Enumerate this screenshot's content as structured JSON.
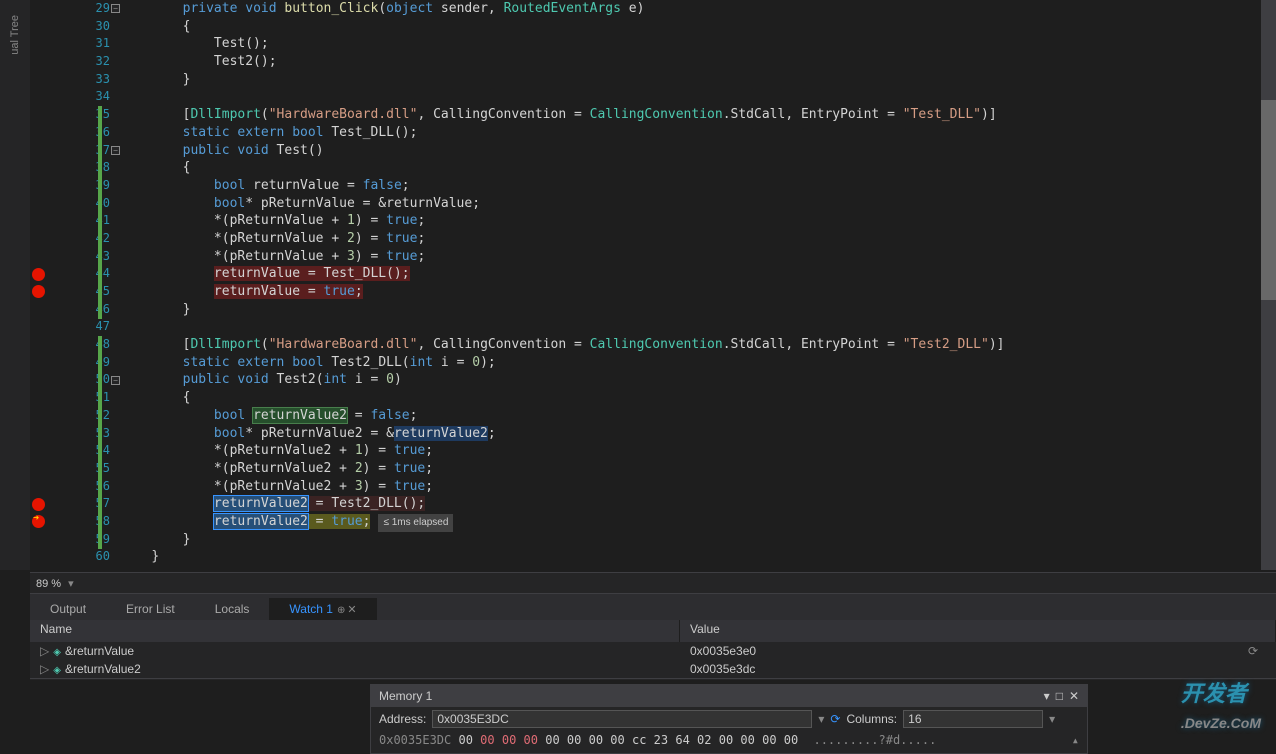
{
  "side_panel": {
    "label": "ual Tree"
  },
  "line_numbers": [
    29,
    30,
    31,
    32,
    33,
    34,
    35,
    36,
    37,
    38,
    39,
    40,
    41,
    42,
    43,
    44,
    45,
    46,
    47,
    48,
    49,
    50,
    51,
    52,
    53,
    54,
    55,
    56,
    57,
    58,
    59,
    60
  ],
  "breakpoints": [
    {
      "line": 44,
      "type": "normal"
    },
    {
      "line": 45,
      "type": "normal"
    },
    {
      "line": 57,
      "type": "normal"
    },
    {
      "line": 58,
      "type": "arrow"
    }
  ],
  "modified_ranges": [
    [
      35,
      46
    ],
    [
      48,
      59
    ]
  ],
  "fold_markers": [
    29,
    37,
    50
  ],
  "code_lines": [
    {
      "n": 29,
      "indent": 2,
      "tokens": [
        {
          "t": "private",
          "c": "k"
        },
        {
          "t": " "
        },
        {
          "t": "void",
          "c": "k"
        },
        {
          "t": " "
        },
        {
          "t": "button_Click",
          "c": "m"
        },
        {
          "t": "("
        },
        {
          "t": "object",
          "c": "k"
        },
        {
          "t": " sender, "
        },
        {
          "t": "RoutedEventArgs",
          "c": "t"
        },
        {
          "t": " e)"
        }
      ]
    },
    {
      "n": 30,
      "indent": 2,
      "tokens": [
        {
          "t": "{"
        }
      ]
    },
    {
      "n": 31,
      "indent": 3,
      "tokens": [
        {
          "t": "Test();"
        }
      ]
    },
    {
      "n": 32,
      "indent": 3,
      "tokens": [
        {
          "t": "Test2();"
        }
      ]
    },
    {
      "n": 33,
      "indent": 2,
      "tokens": [
        {
          "t": "}"
        }
      ]
    },
    {
      "n": 34,
      "indent": 0,
      "tokens": []
    },
    {
      "n": 35,
      "indent": 2,
      "tokens": [
        {
          "t": "["
        },
        {
          "t": "DllImport",
          "c": "attr"
        },
        {
          "t": "("
        },
        {
          "t": "\"HardwareBoard.dll\"",
          "c": "s"
        },
        {
          "t": ", CallingConvention = "
        },
        {
          "t": "CallingConvention",
          "c": "t"
        },
        {
          "t": ".StdCall, EntryPoint = "
        },
        {
          "t": "\"Test_DLL\"",
          "c": "s"
        },
        {
          "t": ")]"
        }
      ]
    },
    {
      "n": 36,
      "indent": 2,
      "tokens": [
        {
          "t": "static",
          "c": "k"
        },
        {
          "t": " "
        },
        {
          "t": "extern",
          "c": "k"
        },
        {
          "t": " "
        },
        {
          "t": "bool",
          "c": "k"
        },
        {
          "t": " Test_DLL();"
        }
      ]
    },
    {
      "n": 37,
      "indent": 2,
      "tokens": [
        {
          "t": "public",
          "c": "k"
        },
        {
          "t": " "
        },
        {
          "t": "void",
          "c": "k"
        },
        {
          "t": " Test()"
        }
      ]
    },
    {
      "n": 38,
      "indent": 2,
      "tokens": [
        {
          "t": "{"
        }
      ]
    },
    {
      "n": 39,
      "indent": 3,
      "tokens": [
        {
          "t": "bool",
          "c": "k"
        },
        {
          "t": " returnValue = "
        },
        {
          "t": "false",
          "c": "k"
        },
        {
          "t": ";"
        }
      ]
    },
    {
      "n": 40,
      "indent": 3,
      "tokens": [
        {
          "t": "bool",
          "c": "k"
        },
        {
          "t": "* pReturnValue = &returnValue;"
        }
      ]
    },
    {
      "n": 41,
      "indent": 3,
      "tokens": [
        {
          "t": "*(pReturnValue + "
        },
        {
          "t": "1",
          "c": "n"
        },
        {
          "t": ") = "
        },
        {
          "t": "true",
          "c": "k"
        },
        {
          "t": ";"
        }
      ]
    },
    {
      "n": 42,
      "indent": 3,
      "tokens": [
        {
          "t": "*(pReturnValue + "
        },
        {
          "t": "2",
          "c": "n"
        },
        {
          "t": ") = "
        },
        {
          "t": "true",
          "c": "k"
        },
        {
          "t": ";"
        }
      ]
    },
    {
      "n": 43,
      "indent": 3,
      "tokens": [
        {
          "t": "*(pReturnValue + "
        },
        {
          "t": "3",
          "c": "n"
        },
        {
          "t": ") = "
        },
        {
          "t": "true",
          "c": "k"
        },
        {
          "t": ";"
        }
      ]
    },
    {
      "n": 44,
      "indent": 3,
      "tokens": [
        {
          "t": "returnValue = Test_DLL();",
          "hl": "hl-red"
        }
      ]
    },
    {
      "n": 45,
      "indent": 3,
      "tokens": [
        {
          "t": "returnValue = ",
          "hl": "hl-red"
        },
        {
          "t": "true",
          "c": "k",
          "hl": "hl-red"
        },
        {
          "t": ";",
          "hl": "hl-red"
        }
      ]
    },
    {
      "n": 46,
      "indent": 2,
      "tokens": [
        {
          "t": "}"
        }
      ]
    },
    {
      "n": 47,
      "indent": 0,
      "tokens": []
    },
    {
      "n": 48,
      "indent": 2,
      "tokens": [
        {
          "t": "["
        },
        {
          "t": "DllImport",
          "c": "attr"
        },
        {
          "t": "("
        },
        {
          "t": "\"HardwareBoard.dll\"",
          "c": "s"
        },
        {
          "t": ", CallingConvention = "
        },
        {
          "t": "CallingConvention",
          "c": "t"
        },
        {
          "t": ".StdCall, EntryPoint = "
        },
        {
          "t": "\"Test2_DLL\"",
          "c": "s"
        },
        {
          "t": ")]"
        }
      ]
    },
    {
      "n": 49,
      "indent": 2,
      "tokens": [
        {
          "t": "static",
          "c": "k"
        },
        {
          "t": " "
        },
        {
          "t": "extern",
          "c": "k"
        },
        {
          "t": " "
        },
        {
          "t": "bool",
          "c": "k"
        },
        {
          "t": " Test2_DLL("
        },
        {
          "t": "int",
          "c": "k"
        },
        {
          "t": " i = "
        },
        {
          "t": "0",
          "c": "n"
        },
        {
          "t": ");"
        }
      ]
    },
    {
      "n": 50,
      "indent": 2,
      "tokens": [
        {
          "t": "public",
          "c": "k"
        },
        {
          "t": " "
        },
        {
          "t": "void",
          "c": "k"
        },
        {
          "t": " Test2("
        },
        {
          "t": "int",
          "c": "k"
        },
        {
          "t": " i = "
        },
        {
          "t": "0",
          "c": "n"
        },
        {
          "t": ")"
        }
      ]
    },
    {
      "n": 51,
      "indent": 2,
      "tokens": [
        {
          "t": "{"
        }
      ]
    },
    {
      "n": 52,
      "indent": 3,
      "tokens": [
        {
          "t": "bool",
          "c": "k"
        },
        {
          "t": " "
        },
        {
          "t": "returnValue2",
          "hl": "hl-green-box"
        },
        {
          "t": " = "
        },
        {
          "t": "false",
          "c": "k"
        },
        {
          "t": ";"
        }
      ]
    },
    {
      "n": 53,
      "indent": 3,
      "tokens": [
        {
          "t": "bool",
          "c": "k"
        },
        {
          "t": "* pReturnValue2 = &"
        },
        {
          "t": "returnValue2",
          "hl": "hl-blue-dark"
        },
        {
          "t": ";"
        }
      ]
    },
    {
      "n": 54,
      "indent": 3,
      "tokens": [
        {
          "t": "*(pReturnValue2 + "
        },
        {
          "t": "1",
          "c": "n"
        },
        {
          "t": ") = "
        },
        {
          "t": "true",
          "c": "k"
        },
        {
          "t": ";"
        }
      ]
    },
    {
      "n": 55,
      "indent": 3,
      "tokens": [
        {
          "t": "*(pReturnValue2 + "
        },
        {
          "t": "2",
          "c": "n"
        },
        {
          "t": ") = "
        },
        {
          "t": "true",
          "c": "k"
        },
        {
          "t": ";"
        }
      ]
    },
    {
      "n": 56,
      "indent": 3,
      "tokens": [
        {
          "t": "*(pReturnValue2 + "
        },
        {
          "t": "3",
          "c": "n"
        },
        {
          "t": ") = "
        },
        {
          "t": "true",
          "c": "k"
        },
        {
          "t": ";"
        }
      ]
    },
    {
      "n": 57,
      "indent": 3,
      "tokens": [
        {
          "t": "returnValue2",
          "hl": "hl-blue"
        },
        {
          "t": " = Test2_DLL();",
          "hl": "hl-dark"
        }
      ]
    },
    {
      "n": 58,
      "indent": 3,
      "current": true,
      "tokens": [
        {
          "t": "returnValue2",
          "hl": "hl-blue"
        },
        {
          "t": " = ",
          "hl": "hl-yellow"
        },
        {
          "t": "true",
          "c": "k",
          "hl": "hl-yellow"
        },
        {
          "t": ";",
          "hl": "hl-yellow"
        }
      ],
      "hint": "≤ 1ms elapsed"
    },
    {
      "n": 59,
      "indent": 2,
      "tokens": [
        {
          "t": "}"
        }
      ]
    },
    {
      "n": 60,
      "indent": 1,
      "tokens": [
        {
          "t": "}"
        }
      ]
    }
  ],
  "zoom": {
    "value": "89 %"
  },
  "tabs": [
    {
      "label": "Output",
      "active": false
    },
    {
      "label": "Error List",
      "active": false
    },
    {
      "label": "Locals",
      "active": false
    },
    {
      "label": "Watch 1",
      "active": true
    }
  ],
  "watch": {
    "columns": {
      "name": "Name",
      "value": "Value"
    },
    "rows": [
      {
        "name": "&returnValue",
        "value": "0x0035e3e0"
      },
      {
        "name": "&returnValue2",
        "value": "0x0035e3dc"
      }
    ]
  },
  "memory": {
    "title": "Memory 1",
    "address_label": "Address:",
    "address_value": "0x0035E3DC",
    "columns_label": "Columns:",
    "columns_value": "16",
    "row": {
      "addr": "0x0035E3DC",
      "bytes": [
        "00",
        "00",
        "00",
        "00",
        "00",
        "00",
        "00",
        "00",
        "cc",
        "23",
        "64",
        "02",
        "00",
        "00",
        "00",
        "00"
      ],
      "red_indices": [
        1,
        2,
        3
      ],
      "ascii": ".........?#d....."
    }
  },
  "watermark": {
    "text": "开发者",
    "suffix": ".DevZe.CoM"
  }
}
